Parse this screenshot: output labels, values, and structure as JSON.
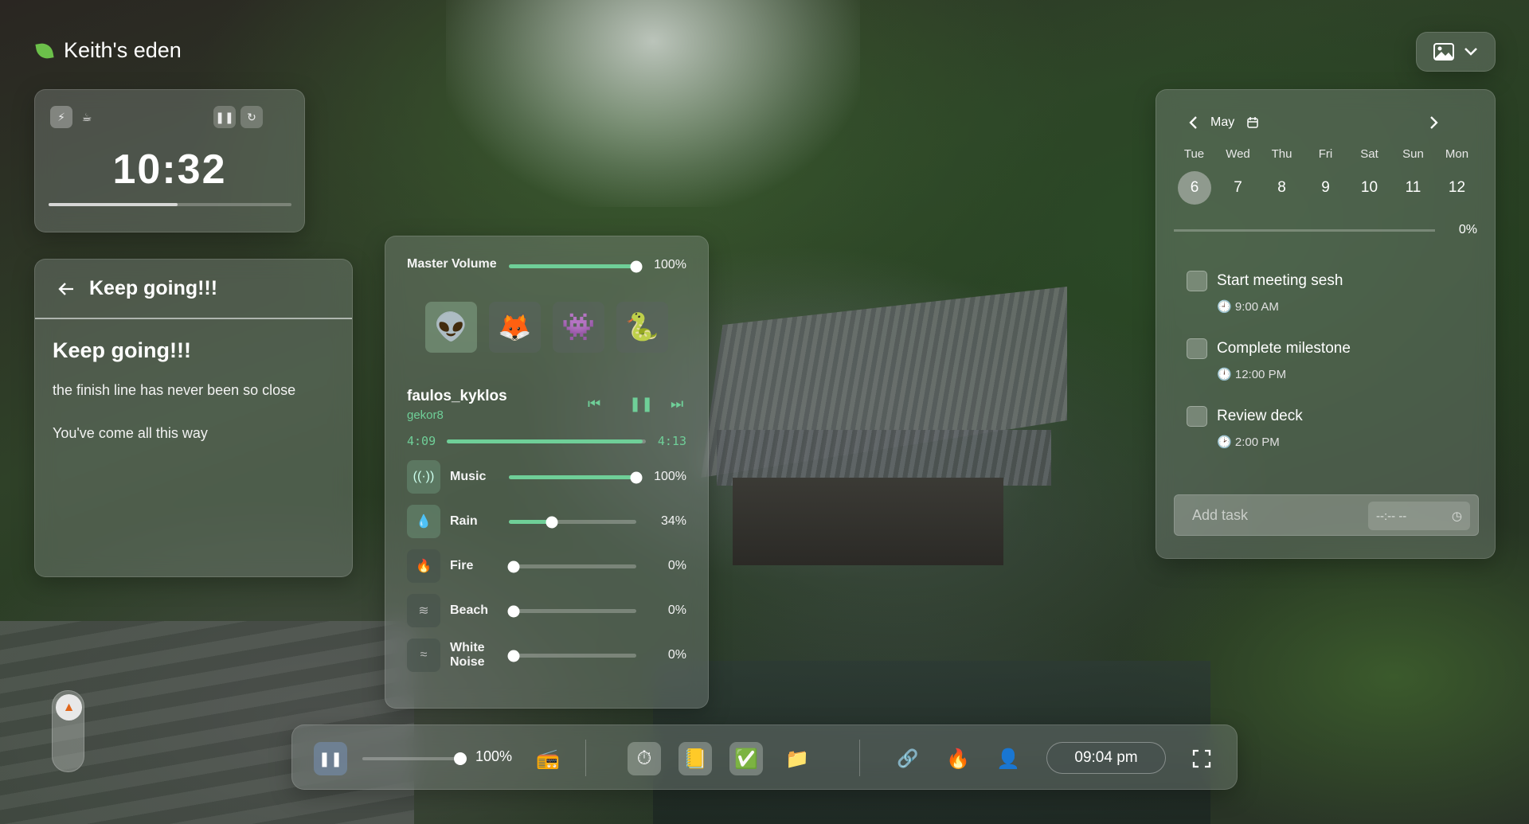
{
  "brand": {
    "title": "Keith's eden"
  },
  "timer": {
    "time": "10:32",
    "progress_fraction": 0.53
  },
  "note": {
    "header_title": "Keep going!!!",
    "heading": "Keep going!!!",
    "lines": [
      "the finish line has never been so close",
      "You've come all this way"
    ]
  },
  "mixer": {
    "master": {
      "label": "Master Volume",
      "value_pct": 100,
      "value_text": "100%"
    },
    "avatars": [
      "👽",
      "🦊",
      "👾",
      "🐍"
    ],
    "track": {
      "name": "faulos_kyklos",
      "artist": "gekor8",
      "elapsed": "4:09",
      "total": "4:13",
      "progress_fraction": 0.985
    },
    "sounds": [
      {
        "label": "Music",
        "value_pct": 100,
        "value_text": "100%",
        "icon": "broadcast-icon",
        "glyph": "((·))"
      },
      {
        "label": "Rain",
        "value_pct": 34,
        "value_text": "34%",
        "icon": "droplet-icon",
        "glyph": "💧"
      },
      {
        "label": "Fire",
        "value_pct": 0,
        "value_text": "0%",
        "icon": "flame-icon",
        "glyph": "🔥"
      },
      {
        "label": "Beach",
        "value_pct": 0,
        "value_text": "0%",
        "icon": "waves-icon",
        "glyph": "≋"
      },
      {
        "label": "White Noise",
        "value_pct": 0,
        "value_text": "0%",
        "icon": "wind-icon",
        "glyph": "≈"
      }
    ]
  },
  "calendar": {
    "month": "May",
    "days": [
      "Tue",
      "Wed",
      "Thu",
      "Fri",
      "Sat",
      "Sun",
      "Mon"
    ],
    "dates": [
      "6",
      "7",
      "8",
      "9",
      "10",
      "11",
      "12"
    ],
    "selected_index": 0,
    "progress_text": "0%",
    "tasks": [
      {
        "title": "Start meeting sesh",
        "time": "9:00 AM"
      },
      {
        "title": "Complete milestone",
        "time": "12:00 PM"
      },
      {
        "title": "Review deck",
        "time": "2:00 PM"
      }
    ],
    "add_task_placeholder": "Add task",
    "time_placeholder": "--:-- --"
  },
  "dock": {
    "volume_pct": 100,
    "volume_text": "100%",
    "clock": "09:04 pm"
  },
  "colors": {
    "accent": "#6fcf98",
    "leaf": "#6cc04a"
  }
}
